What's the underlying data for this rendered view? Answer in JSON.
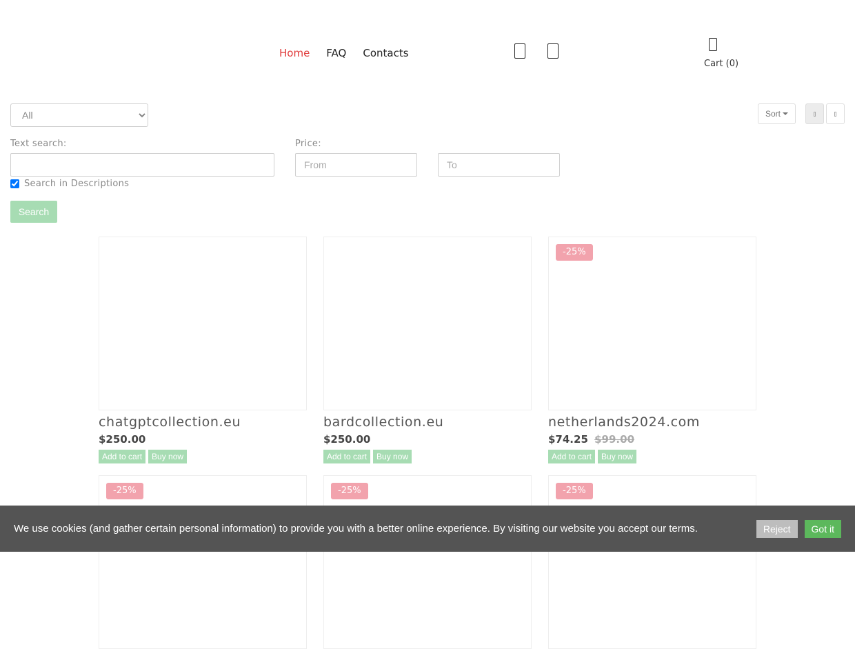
{
  "header": {
    "nav": [
      {
        "label": "Home",
        "active": true
      },
      {
        "label": "FAQ",
        "active": false
      },
      {
        "label": "Contacts",
        "active": false
      }
    ],
    "icons": [
      "user-icon",
      "search-icon",
      "cart-icon"
    ],
    "cart_label": "Cart (0)"
  },
  "filters": {
    "category_selected": "All",
    "sort_label": "Sort",
    "view_modes": [
      "grid-view",
      "list-view"
    ],
    "text_search_label": "Text search:",
    "text_search_value": "",
    "price_label": "Price:",
    "price_from_placeholder": "From",
    "price_to_placeholder": "To",
    "search_in_descriptions_label": "Search in Descriptions",
    "search_in_descriptions_checked": true,
    "search_button": "Search"
  },
  "products": [
    {
      "name": "chatgptcollection.eu",
      "price": "$250.00",
      "old_price": "",
      "badge": "",
      "add_to_cart": "Add to cart",
      "buy_now": "Buy now"
    },
    {
      "name": "bardcollection.eu",
      "price": "$250.00",
      "old_price": "",
      "badge": "",
      "add_to_cart": "Add to cart",
      "buy_now": "Buy now"
    },
    {
      "name": "netherlands2024.com",
      "price": "$74.25",
      "old_price": "$99.00",
      "badge": "-25%",
      "add_to_cart": "Add to cart",
      "buy_now": "Buy now"
    },
    {
      "badge": "-25%"
    },
    {
      "badge": "-25%"
    },
    {
      "badge": "-25%"
    }
  ],
  "cookie": {
    "text": "We use cookies (and gather certain personal information) to provide you with a better online experience. By visiting our website you accept our terms.",
    "reject": "Reject",
    "accept": "Got it"
  },
  "colors": {
    "accent_red": "#e03a3a",
    "button_green_light": "#a7dcb3",
    "badge_pink": "#f2a3ad",
    "cookie_bg": "#545454",
    "accept_green": "#5cb85c"
  }
}
